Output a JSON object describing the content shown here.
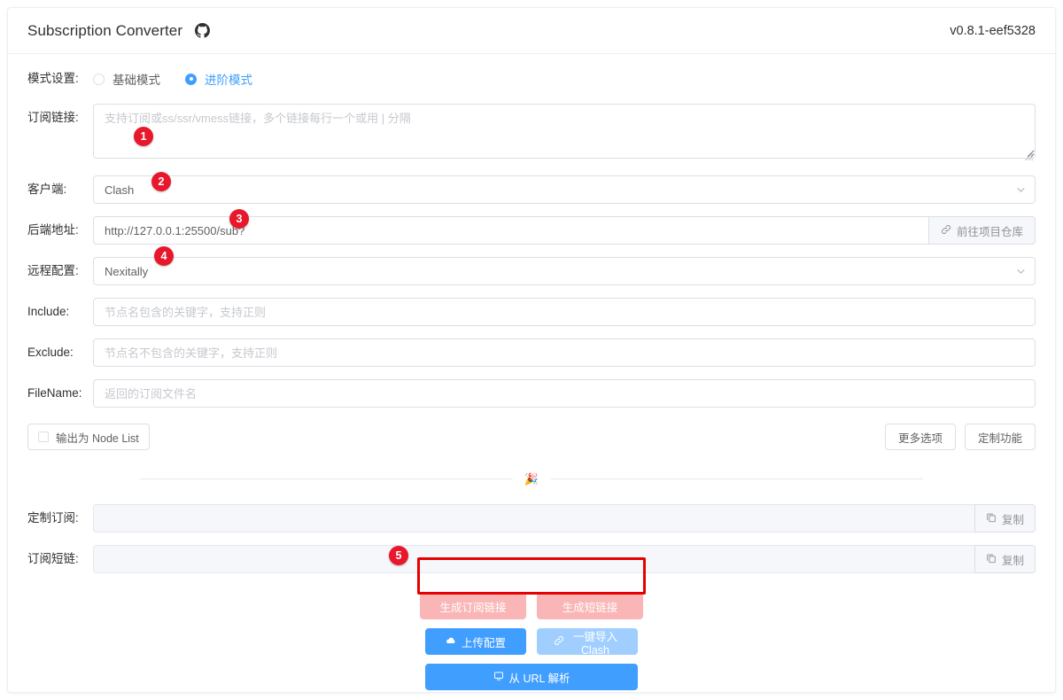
{
  "header": {
    "title": "Subscription Converter",
    "github_icon": "github-icon",
    "version": "v0.8.1-eef5328"
  },
  "mode": {
    "label": "模式设置:",
    "options": [
      {
        "label": "基础模式",
        "selected": false
      },
      {
        "label": "进阶模式",
        "selected": true
      }
    ]
  },
  "fields": {
    "sub_link": {
      "label": "订阅链接:",
      "placeholder": "支持订阅或ss/ssr/vmess链接，多个链接每行一个或用 | 分隔",
      "value": ""
    },
    "client": {
      "label": "客户端:",
      "value": "Clash",
      "chevron": "chevron-down-icon"
    },
    "backend": {
      "label": "后端地址:",
      "value": "http://127.0.0.1:25500/sub?",
      "append_label": "前往项目仓库",
      "append_icon": "link-icon"
    },
    "remote_config": {
      "label": "远程配置:",
      "value": "Nexitally",
      "chevron": "chevron-down-icon"
    },
    "include": {
      "label": "Include:",
      "placeholder": "节点名包含的关键字，支持正则",
      "value": ""
    },
    "exclude": {
      "label": "Exclude:",
      "placeholder": "节点名不包含的关键字，支持正则",
      "value": ""
    },
    "filename": {
      "label": "FileName:",
      "placeholder": "返回的订阅文件名",
      "value": ""
    }
  },
  "options_row": {
    "node_list_label": "输出为 Node List",
    "node_list_checked": false,
    "more_options_label": "更多选项",
    "custom_features_label": "定制功能"
  },
  "divider": {
    "emoji": "🎉"
  },
  "results": {
    "custom_sub": {
      "label": "定制订阅:",
      "value": "",
      "copy_label": "复制",
      "copy_icon": "copy-icon"
    },
    "short_link": {
      "label": "订阅短链:",
      "value": "",
      "copy_label": "复制",
      "copy_icon": "copy-icon"
    }
  },
  "actions": {
    "generate_sub": "生成订阅链接",
    "generate_short": "生成短链接",
    "upload_config": "上传配置",
    "upload_icon": "cloud-upload-icon",
    "import_clash": "一键导入 Clash",
    "import_icon": "link-chain-icon",
    "parse_url": "从 URL 解析",
    "parse_icon": "monitor-icon"
  },
  "badges": [
    {
      "n": "1"
    },
    {
      "n": "2"
    },
    {
      "n": "3"
    },
    {
      "n": "4"
    },
    {
      "n": "5"
    }
  ],
  "colors": {
    "primary": "#409eff",
    "primary_disabled": "#a0cfff",
    "danger_disabled": "#fab6b6",
    "badge_red": "#e8182c",
    "highlight_red": "#e60000",
    "border": "#dcdfe6",
    "text": "#303133"
  }
}
